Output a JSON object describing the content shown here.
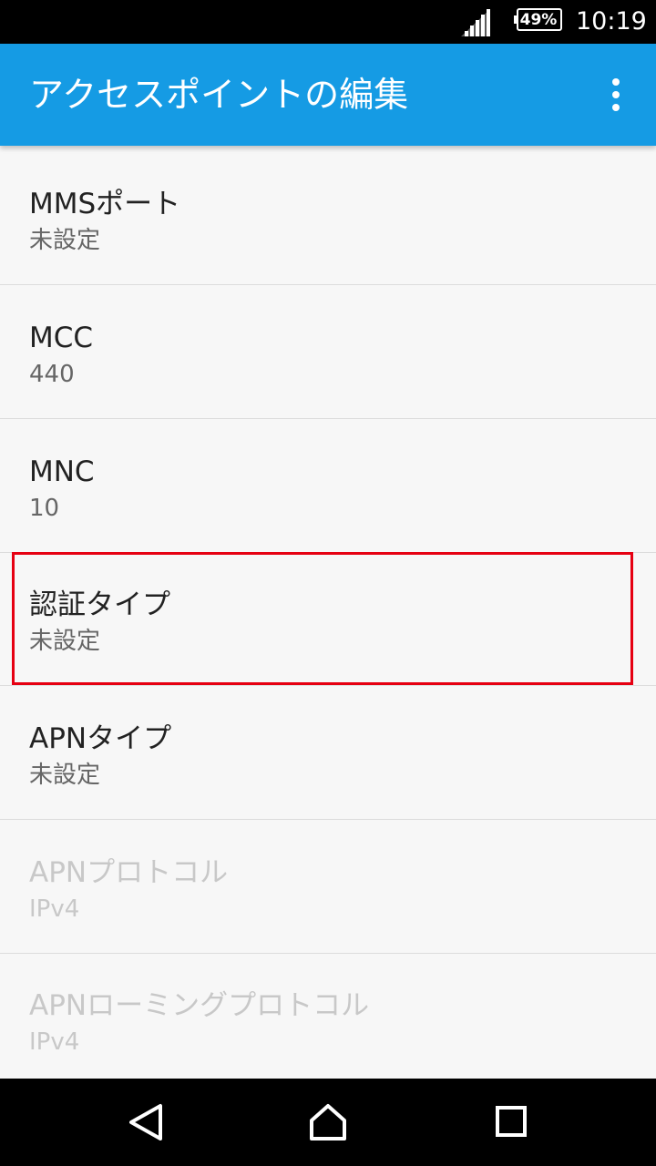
{
  "status_bar": {
    "signal_icon": "signal-strength-icon",
    "battery_percent": "49%",
    "time": "10:19"
  },
  "app_bar": {
    "title": "アクセスポイントの編集",
    "menu_icon": "more-vert-icon",
    "background_color": "#159be4"
  },
  "settings": [
    {
      "title": "MMSポート",
      "summary": "未設定",
      "enabled": true
    },
    {
      "title": "MCC",
      "summary": "440",
      "enabled": true
    },
    {
      "title": "MNC",
      "summary": "10",
      "enabled": true
    },
    {
      "title": "認証タイプ",
      "summary": "未設定",
      "enabled": true,
      "highlighted": true
    },
    {
      "title": "APNタイプ",
      "summary": "未設定",
      "enabled": true
    },
    {
      "title": "APNプロトコル",
      "summary": "IPv4",
      "enabled": false
    },
    {
      "title": "APNローミングプロトコル",
      "summary": "IPv4",
      "enabled": false
    }
  ],
  "highlight_color": "#e60012",
  "nav_bar": {
    "back_icon": "back-triangle-icon",
    "home_icon": "home-icon",
    "recents_icon": "recents-square-icon"
  }
}
